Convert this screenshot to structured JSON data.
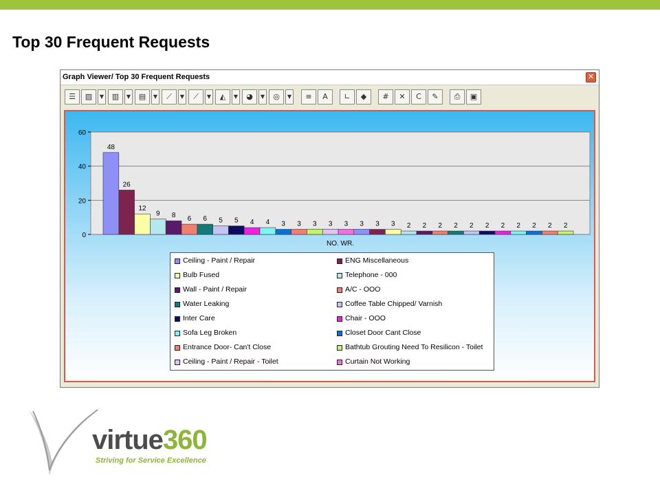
{
  "slide": {
    "title": "Top 30 Frequent Requests"
  },
  "window": {
    "title": "Graph Viewer/ Top 30 Frequent Requests",
    "close_label": "✕"
  },
  "toolbar": {
    "buttons": [
      {
        "name": "list-icon",
        "glyph": "☰"
      },
      {
        "name": "chart-image-icon",
        "glyph": "▨"
      },
      {
        "name": "bar-chart-type-icon",
        "glyph": "▥"
      },
      {
        "name": "stacked-bar-icon",
        "glyph": "▤"
      },
      {
        "name": "line-chart-icon",
        "glyph": "⟋"
      },
      {
        "name": "multi-line-icon",
        "glyph": "⟋"
      },
      {
        "name": "area-chart-icon",
        "glyph": "◭"
      },
      {
        "name": "pie-chart-icon",
        "glyph": "◕"
      },
      {
        "name": "donut-chart-icon",
        "glyph": "◎"
      },
      {
        "name": "data-icon",
        "glyph": "≡"
      },
      {
        "name": "abc-icon",
        "glyph": "A"
      },
      {
        "name": "axis-icon",
        "glyph": "∟"
      },
      {
        "name": "3d-icon",
        "glyph": "◆"
      },
      {
        "name": "values-icon",
        "glyph": "#"
      },
      {
        "name": "close-chart-icon",
        "glyph": "✕"
      },
      {
        "name": "c-icon",
        "glyph": "C"
      },
      {
        "name": "tools-icon",
        "glyph": "✎"
      },
      {
        "name": "print-icon",
        "glyph": "⎙"
      },
      {
        "name": "save-icon",
        "glyph": "▣"
      }
    ]
  },
  "chart_data": {
    "type": "bar",
    "title": "",
    "xlabel": "NO. WR.",
    "ylabel": "",
    "ylim": [
      0,
      60
    ],
    "yticks": [
      0,
      20,
      40,
      60
    ],
    "grid": true,
    "legend_position": "bottom",
    "series": [
      {
        "name": "Ceiling - Paint / Repair",
        "value": 48,
        "color": "#8f8ff8"
      },
      {
        "name": "ENG Miscellaneous",
        "value": 26,
        "color": "#7e2350"
      },
      {
        "name": "Bulb Fused",
        "value": 12,
        "color": "#ffffa8"
      },
      {
        "name": "Telephone - 000",
        "value": 9,
        "color": "#b5e8ec"
      },
      {
        "name": "Wall - Paint / Repair",
        "value": 8,
        "color": "#5a1a6a"
      },
      {
        "name": "A/C - OOO",
        "value": 6,
        "color": "#f07f70"
      },
      {
        "name": "Water Leaking",
        "value": 6,
        "color": "#127a78"
      },
      {
        "name": "Coffee Table Chipped/ Varnish",
        "value": 5,
        "color": "#c4c4f4"
      },
      {
        "name": "Inter Care",
        "value": 5,
        "color": "#0c0c66"
      },
      {
        "name": "Chair - OOO",
        "value": 4,
        "color": "#f020e0"
      },
      {
        "name": "Sofa Leg Broken",
        "value": 4,
        "color": "#80f4f4"
      },
      {
        "name": "Closet Door Cant Close",
        "value": 3,
        "color": "#0b6fd8"
      },
      {
        "name": "Entrance Door- Can't Close",
        "value": 3,
        "color": "#f07f70"
      },
      {
        "name": "Bathtub Grouting Need To Resilicon - Toilet",
        "value": 3,
        "color": "#c8f070"
      },
      {
        "name": "Ceiling - Paint / Repair - Toilet",
        "value": 3,
        "color": "#e0c4f0"
      },
      {
        "name": "Curtain Not Working",
        "value": 3,
        "color": "#f070e0"
      },
      {
        "name": "",
        "value": 3,
        "color": "#8f8ff8"
      },
      {
        "name": "",
        "value": 3,
        "color": "#7e2350"
      },
      {
        "name": "",
        "value": 3,
        "color": "#ffffa8"
      },
      {
        "name": "",
        "value": 2,
        "color": "#b5e8ec"
      },
      {
        "name": "",
        "value": 2,
        "color": "#5a1a6a"
      },
      {
        "name": "",
        "value": 2,
        "color": "#f07f70"
      },
      {
        "name": "",
        "value": 2,
        "color": "#127a78"
      },
      {
        "name": "",
        "value": 2,
        "color": "#c4c4f4"
      },
      {
        "name": "",
        "value": 2,
        "color": "#0c0c66"
      },
      {
        "name": "",
        "value": 2,
        "color": "#f020e0"
      },
      {
        "name": "",
        "value": 2,
        "color": "#80f4f4"
      },
      {
        "name": "",
        "value": 2,
        "color": "#0b6fd8"
      },
      {
        "name": "",
        "value": 2,
        "color": "#f07f70"
      },
      {
        "name": "",
        "value": 2,
        "color": "#c8f070"
      }
    ]
  },
  "legend": {
    "items": [
      {
        "label": "Ceiling - Paint / Repair",
        "color": "#8f8ff8"
      },
      {
        "label": "ENG Miscellaneous",
        "color": "#7e2350"
      },
      {
        "label": "Bulb Fused",
        "color": "#ffffa8"
      },
      {
        "label": "Telephone - 000",
        "color": "#b5e8ec"
      },
      {
        "label": "Wall - Paint / Repair",
        "color": "#5a1a6a"
      },
      {
        "label": "A/C - OOO",
        "color": "#f07f70"
      },
      {
        "label": "Water Leaking",
        "color": "#127a78"
      },
      {
        "label": "Coffee Table Chipped/ Varnish",
        "color": "#c4c4f4"
      },
      {
        "label": "Inter Care",
        "color": "#0c0c66"
      },
      {
        "label": "Chair - OOO",
        "color": "#f020e0"
      },
      {
        "label": "Sofa Leg Broken",
        "color": "#80f4f4"
      },
      {
        "label": "Closet Door Cant Close",
        "color": "#0b6fd8"
      },
      {
        "label": "Entrance Door- Can't Close",
        "color": "#f07f70"
      },
      {
        "label": "Bathtub Grouting Need To Resilicon - Toilet",
        "color": "#c8f070"
      },
      {
        "label": "Ceiling - Paint / Repair - Toilet",
        "color": "#e0c4f0"
      },
      {
        "label": "Curtain Not Working",
        "color": "#f070e0"
      }
    ]
  },
  "logo": {
    "brand_word": "virtue",
    "brand_number": "360",
    "tagline": "Striving for Service Excellence"
  },
  "colors": {
    "accent": "#9ec43c",
    "brand_green": "#8db53a",
    "frame_red": "#d85a4f"
  }
}
